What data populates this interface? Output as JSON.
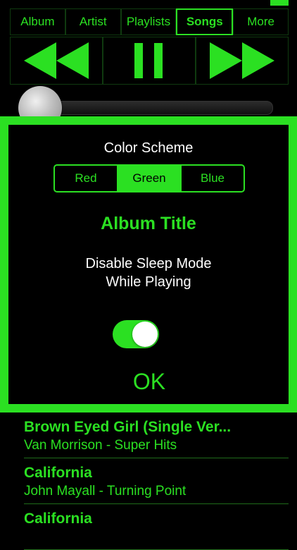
{
  "tabs": [
    {
      "label": "Album",
      "selected": false
    },
    {
      "label": "Artist",
      "selected": false
    },
    {
      "label": "Playlists",
      "selected": false
    },
    {
      "label": "Songs",
      "selected": true
    },
    {
      "label": "More",
      "selected": false
    }
  ],
  "transport": {
    "rewind_icon": "rewind-icon",
    "pause_icon": "pause-icon",
    "fast_forward_icon": "fast-forward-icon"
  },
  "slider": {
    "position": 0.0
  },
  "settings": {
    "color_scheme_label": "Color Scheme",
    "color_options": [
      "Red",
      "Green",
      "Blue"
    ],
    "selected_color": "Green",
    "album_title": "Album Title",
    "sleep_label_line1": "Disable Sleep Mode",
    "sleep_label_line2": "While Playing",
    "sleep_toggle_on": true,
    "ok_label": "OK"
  },
  "songs": [
    {
      "title": "Brown Eyed Girl (Single Ver...",
      "subtitle": "Van Morrison - Super Hits"
    },
    {
      "title": "California",
      "subtitle": "John Mayall - Turning Point"
    },
    {
      "title": "California",
      "subtitle": ""
    }
  ],
  "colors": {
    "accent": "#2be022",
    "background": "#000000",
    "text_white": "#ffffff"
  }
}
